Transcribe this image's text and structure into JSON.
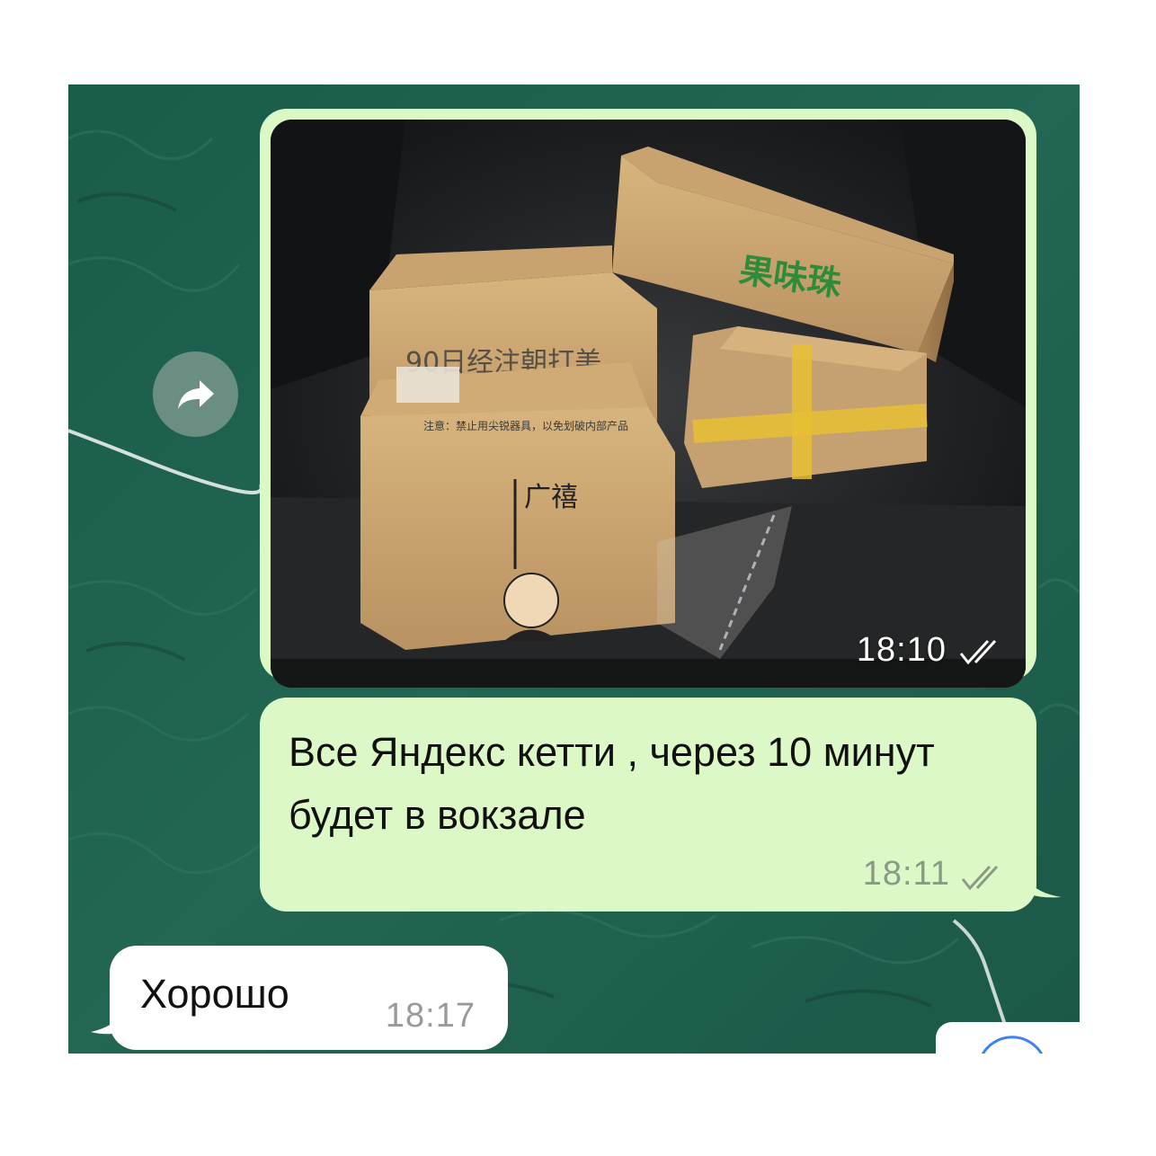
{
  "messages": [
    {
      "type": "photo",
      "direction": "outgoing",
      "time": "18:10",
      "status": "read",
      "photo_labels": {
        "box_top": "果味珠",
        "box_front": "广禧"
      }
    },
    {
      "type": "text",
      "direction": "outgoing",
      "text": "Все Яндекс кетти , через 10 минут будет в вокзале",
      "time": "18:11",
      "status": "read"
    },
    {
      "type": "text",
      "direction": "incoming",
      "text": "Хорошо",
      "time": "18:17"
    }
  ],
  "icons": {
    "forward": "forward-arrow-icon",
    "read_ticks": "double-check-icon"
  },
  "colors": {
    "wallpaper": "#1f5d4c",
    "outgoing_bubble": "#dcf8c6",
    "incoming_bubble": "#ffffff",
    "forward_button": "#7a968c"
  }
}
